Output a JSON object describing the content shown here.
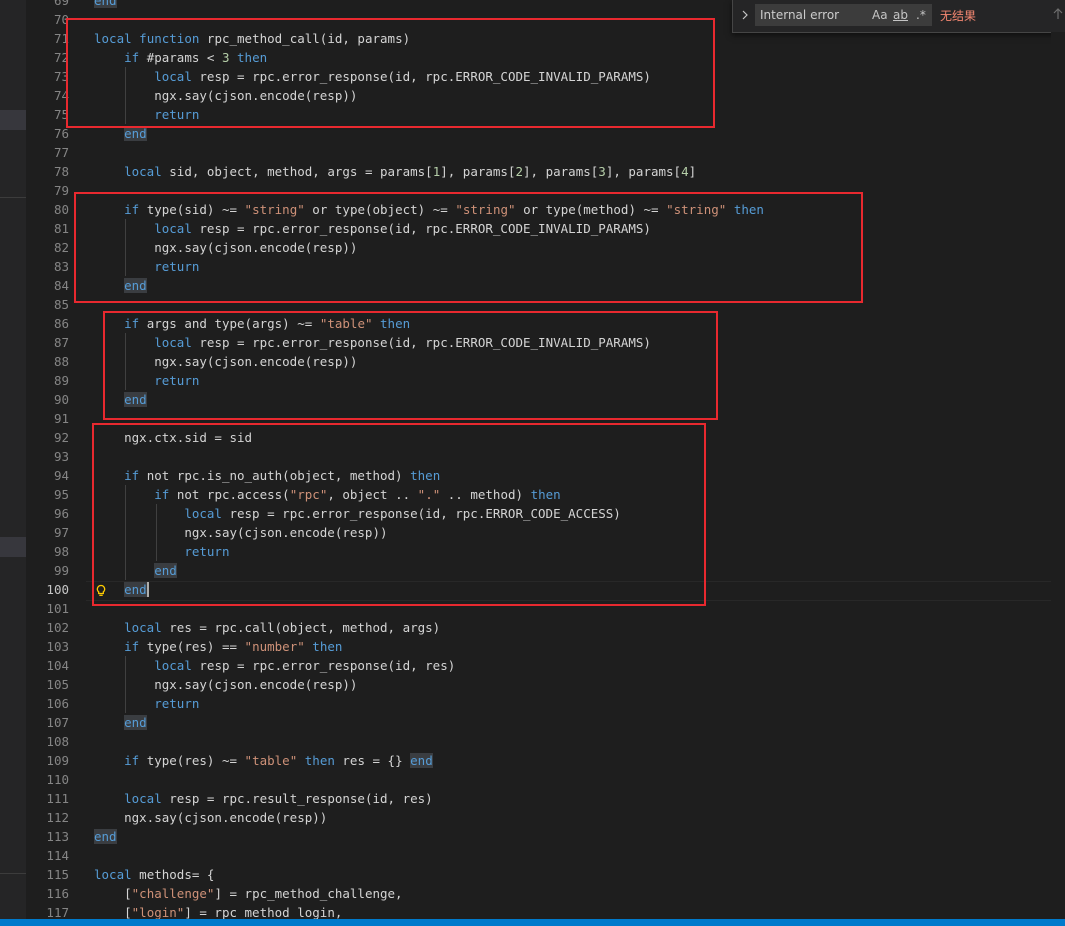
{
  "find_widget": {
    "toggle_icon": "chevron-right-icon",
    "query": "Internal error",
    "match_case": "Aa",
    "whole_word": "ab",
    "regex": ".*",
    "result": "无结果",
    "prev_icon": "arrow-up-icon"
  },
  "editor": {
    "active_line": "100",
    "lightbulb_icon": "lightbulb-icon",
    "line_numbers": [
      "69",
      "70",
      "71",
      "72",
      "73",
      "74",
      "75",
      "76",
      "77",
      "78",
      "79",
      "80",
      "81",
      "82",
      "83",
      "84",
      "85",
      "86",
      "87",
      "88",
      "89",
      "90",
      "91",
      "92",
      "93",
      "94",
      "95",
      "96",
      "97",
      "98",
      "99",
      "100",
      "101",
      "102",
      "103",
      "104",
      "105",
      "106",
      "107",
      "108",
      "109",
      "110",
      "111",
      "112",
      "113",
      "114",
      "115",
      "116",
      "117"
    ],
    "tokens": {
      "end": "end",
      "local": "local",
      "function": "function",
      "if": "if",
      "then": "then",
      "return": "return",
      "or": "or",
      "and": "and",
      "not": "not",
      "l71_sig": "rpc_method_call(id, params)",
      "l72_cond": "#params < ",
      "three": "3",
      "resp_eq": "resp = rpc.error_response(id, rpc.ERROR_CODE_INVALID_PARAMS)",
      "say": "ngx.say(cjson.encode(resp))",
      "l78_a": "sid, object, method, args = params[",
      "idx1": "1",
      "idx2": "2",
      "idx3": "3",
      "idx4": "4",
      "sep_params": "], params[",
      "close_br": "]",
      "type_sid": "type(sid) ~= ",
      "type_object": "type(object) ~= ",
      "type_method": "type(method) ~= ",
      "str_string": "\"string\"",
      "args": "args",
      "type_args": "type(args) ~= ",
      "str_table": "\"table\"",
      "l92": "ngx.ctx.sid = sid",
      "is_no_auth": "rpc.is_no_auth(object, method)",
      "access_a": "rpc.access(",
      "str_rpc": "\"rpc\"",
      "concat_a": ", object .. ",
      "str_dot": "\".\"",
      "concat_b": " .. method)",
      "resp_access": "resp = rpc.error_response(id, rpc.ERROR_CODE_ACCESS)",
      "l102": "res = rpc.call(object, method, args)",
      "type_res_eq": "type(res) == ",
      "str_number": "\"number\"",
      "resp_res": "resp = rpc.error_response(id, res)",
      "type_res_ne": "type(res) ~= ",
      "res_assign": "res = {}",
      "l111": "resp = rpc.result_response(id, res)",
      "l112": "ngx.say(cjson.encode(resp))",
      "l115": "methods= {",
      "str_challenge": "\"challenge\"",
      "l116_rest": "] = rpc_method_challenge,",
      "str_login": "\"login\"",
      "l117_rest": "] = rpc_method_login,",
      "open_br": "["
    }
  },
  "colors": {
    "keyword": "#569cd6",
    "string": "#ce9178",
    "number": "#b5cea8",
    "highlight_box": "#e8292f",
    "status_bar": "#007acc",
    "no_result": "#f48771"
  }
}
